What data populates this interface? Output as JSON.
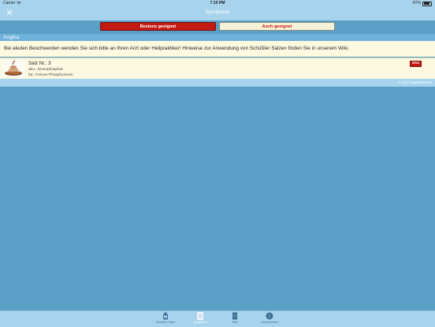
{
  "status_bar": {
    "carrier": "Carrier",
    "time": "7:10 PM",
    "battery": "87%",
    "battery_level": 0.87
  },
  "nav": {
    "title": "Symptome",
    "close_icon": "close-icon"
  },
  "segments": {
    "best": "Bestens geeignet",
    "also": "Auch geeignet",
    "selected": "best"
  },
  "section": {
    "title": "Angina"
  },
  "notice": {
    "text": "Bei akuten Beschwerden wenden Sie sich bitte an Ihren Arzt oder Heilpraktiker! Hinweise zur Anwendung von Schüßler Salzen finden Sie in unserem Wiki."
  },
  "salts": [
    {
      "name": "Salz Nr.: 3",
      "de": "deu.: Eisenphosphat",
      "lat": "lat.:   Ferrum Phosphoricum",
      "badge": "D12"
    }
  ],
  "footer": {
    "copyright": "© 2017 Appstreet.net"
  },
  "tabs": [
    {
      "label": "Schüßler Salze",
      "icon": "bottle-icon"
    },
    {
      "label": "Symptome",
      "icon": "list-icon"
    },
    {
      "label": "Wiki",
      "icon": "book-icon"
    },
    {
      "label": "Informationen",
      "icon": "info-icon"
    }
  ],
  "selected_tab": 1,
  "colors": {
    "accent_red": "#c41a14",
    "bar_blue": "#a8d3ec",
    "background_blue": "#5a9fc6",
    "cream": "#fdf9e1"
  }
}
